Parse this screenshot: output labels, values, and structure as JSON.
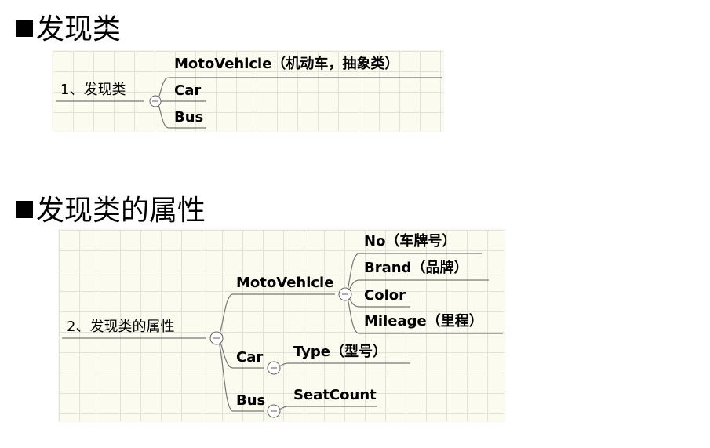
{
  "section1": {
    "heading": "发现类",
    "root": "1、发现类",
    "children": [
      "MotoVehicle（机动车，抽象类）",
      "Car",
      "Bus"
    ]
  },
  "section2": {
    "heading": "发现类的属性",
    "root": "2、发现类的属性",
    "motovehicle": {
      "label": "MotoVehicle",
      "attributes": [
        "No（车牌号）",
        "Brand（品牌）",
        "Color",
        "Mileage（里程）"
      ]
    },
    "car": {
      "label": "Car",
      "attributes": [
        "Type（型号）"
      ]
    },
    "bus": {
      "label": "Bus",
      "attributes": [
        "SeatCount"
      ]
    }
  },
  "colors": {
    "grid_background": "#fbfbef",
    "grid_line": "#e4e4cc",
    "connector": "#777777"
  },
  "icons": {
    "bullet": "black-square-bullet",
    "collapse": "collapse-minus-icon"
  }
}
